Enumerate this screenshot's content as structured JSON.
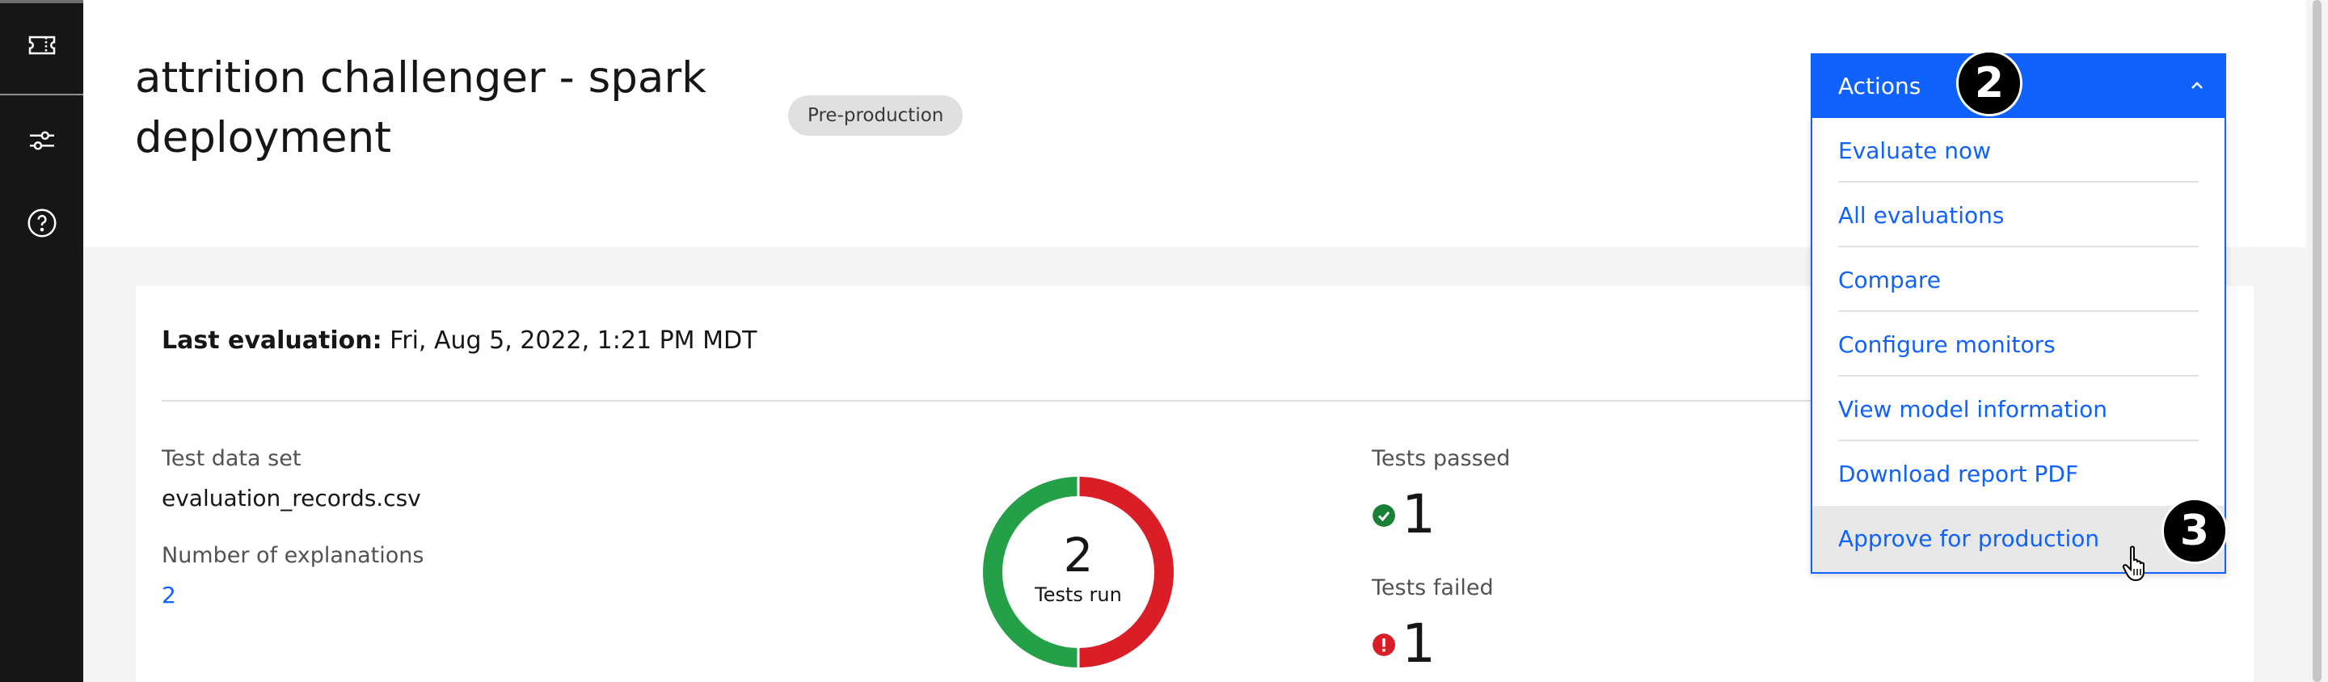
{
  "sidebar": {
    "items": [
      {
        "icon": "ticket-icon"
      },
      {
        "icon": "sliders-icon"
      },
      {
        "icon": "help-icon"
      }
    ]
  },
  "header": {
    "title": "attrition challenger - spark deployment",
    "tag": "Pre-production"
  },
  "actions": {
    "label": "Actions",
    "items": [
      "Evaluate now",
      "All evaluations",
      "Compare",
      "Configure monitors",
      "View model information",
      "Download report PDF",
      "Approve for production"
    ]
  },
  "evaluation": {
    "last_eval_label": "Last evaluation:",
    "last_eval_value": "Fri, Aug 5, 2022, 1:21 PM MDT",
    "test_data_set_label": "Test data set",
    "test_data_set_value": "evaluation_records.csv",
    "explanations_label": "Number of explanations",
    "explanations_value": "2",
    "tests_run": "2",
    "tests_run_label": "Tests run",
    "tests_passed_label": "Tests passed",
    "tests_passed": "1",
    "tests_failed_label": "Tests failed",
    "tests_failed": "1"
  },
  "callouts": [
    "2",
    "3"
  ],
  "colors": {
    "accent": "#0f62fe",
    "pass": "#24a148",
    "fail": "#da1e28",
    "sidebar": "#161616"
  }
}
